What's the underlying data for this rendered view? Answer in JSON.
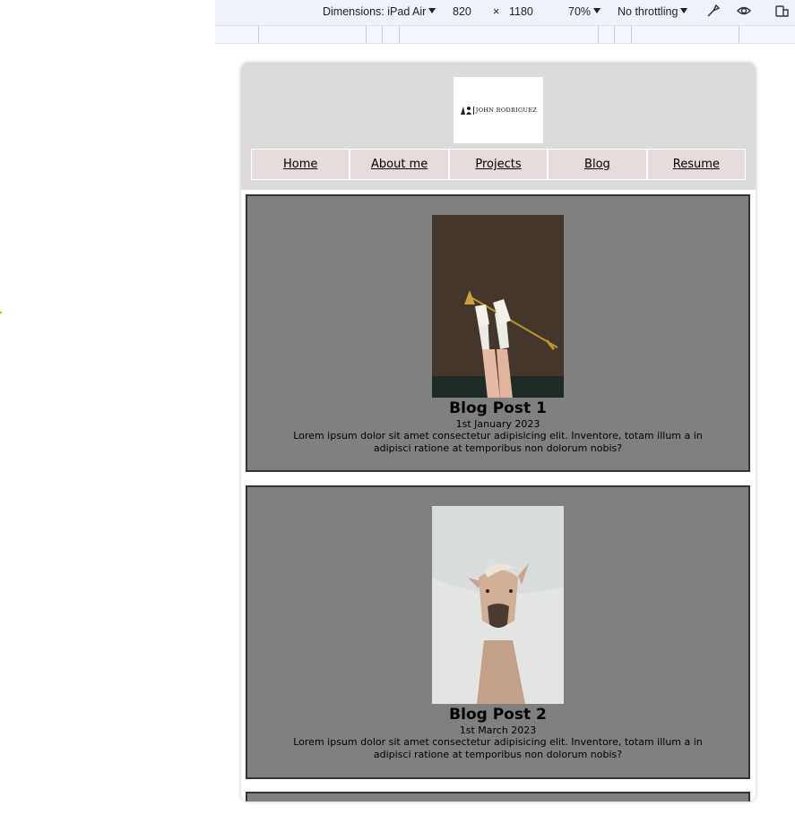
{
  "devtools": {
    "dimensions_label": "Dimensions: iPad Air",
    "width": "820",
    "times": "×",
    "height": "1180",
    "zoom": "70%",
    "throttling": "No throttling"
  },
  "site": {
    "logo_text": "JOHN RODRIGUEZ",
    "nav": [
      {
        "label": "Home"
      },
      {
        "label": "About me"
      },
      {
        "label": "Projects"
      },
      {
        "label": "Blog"
      },
      {
        "label": "Resume"
      }
    ]
  },
  "posts": [
    {
      "title": "Blog Post 1",
      "date": "1st January 2023",
      "text": "Lorem ipsum dolor sit amet consectetur adipisicing elit. Inventore, totam illum a in adipisci ratione at temporibus non dolorum nobis?",
      "image": "legs-with-sneakers-and-floor-lamp"
    },
    {
      "title": "Blog Post 2",
      "date": "1st March 2023",
      "text": "Lorem ipsum dolor sit amet consectetur adipisicing elit. Inventore, totam illum a in adipisci ratione at temporibus non dolorum nobis?",
      "image": "horse-portrait"
    }
  ],
  "colors": {
    "header_bg": "#dcdadb",
    "nav_bg": "#e6dcdc",
    "post_bg": "#808080",
    "post_border": "#333333",
    "devtools_bg": "#eef3fb"
  }
}
